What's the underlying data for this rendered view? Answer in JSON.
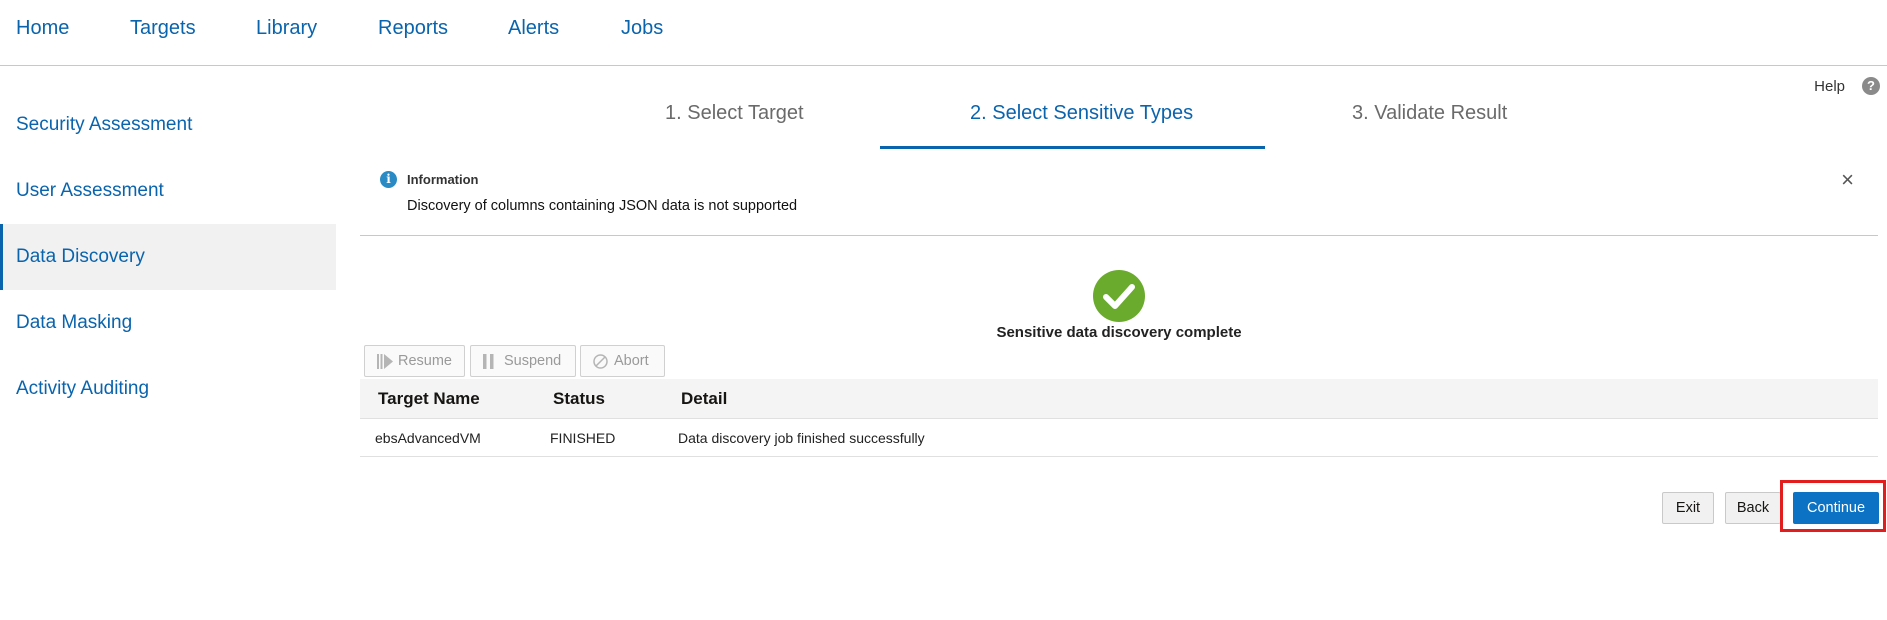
{
  "topnav": {
    "items": [
      {
        "label": "Home"
      },
      {
        "label": "Targets"
      },
      {
        "label": "Library"
      },
      {
        "label": "Reports"
      },
      {
        "label": "Alerts"
      },
      {
        "label": "Jobs"
      }
    ]
  },
  "help": {
    "label": "Help",
    "icon": "?"
  },
  "sidebar": {
    "items": [
      {
        "label": "Security Assessment"
      },
      {
        "label": "User Assessment"
      },
      {
        "label": "Data Discovery",
        "active": true
      },
      {
        "label": "Data Masking"
      },
      {
        "label": "Activity Auditing"
      }
    ]
  },
  "wizard": {
    "steps": [
      {
        "label": "1. Select Target"
      },
      {
        "label": "2. Select Sensitive Types",
        "active": true
      },
      {
        "label": "3. Validate Result"
      }
    ]
  },
  "info_banner": {
    "icon": "i",
    "title": "Information",
    "message": "Discovery of columns containing JSON data is not supported",
    "close": "×"
  },
  "status": {
    "message": "Sensitive data discovery complete",
    "color": "#6aab2e"
  },
  "job_actions": {
    "resume": "Resume",
    "suspend": "Suspend",
    "abort": "Abort"
  },
  "table": {
    "headers": [
      "Target Name",
      "Status",
      "Detail"
    ],
    "rows": [
      [
        "ebsAdvancedVM",
        "FINISHED",
        "Data discovery job finished successfully"
      ]
    ]
  },
  "footer": {
    "exit": "Exit",
    "back": "Back",
    "continue": "Continue"
  },
  "colors": {
    "accent": "#0a64ad",
    "primary_button": "#0b72c4",
    "highlight": "#e21d1d"
  }
}
